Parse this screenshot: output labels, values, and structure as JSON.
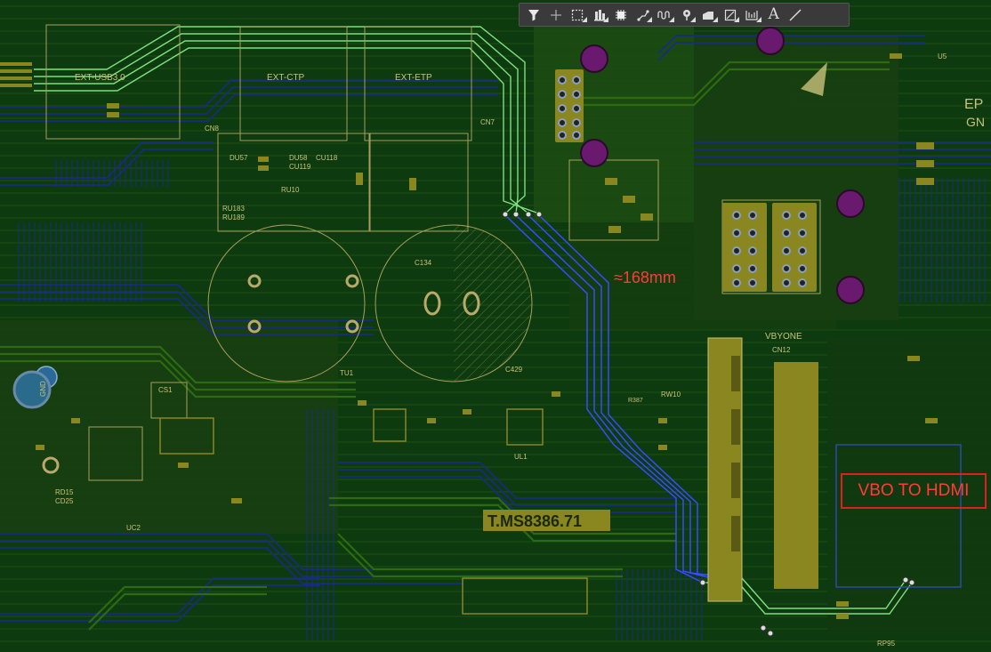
{
  "toolbar": {
    "tools": [
      {
        "icon": "filter-icon",
        "tooltip": "Filter"
      },
      {
        "icon": "crosshair-icon",
        "tooltip": "Place"
      },
      {
        "icon": "select-rectangle-icon",
        "tooltip": "Select"
      },
      {
        "icon": "align-icon",
        "tooltip": "Align"
      },
      {
        "icon": "component-icon",
        "tooltip": "Component"
      },
      {
        "icon": "route-track-icon",
        "tooltip": "Route"
      },
      {
        "icon": "diff-pair-length-icon",
        "tooltip": "Length Tuning"
      },
      {
        "icon": "via-icon",
        "tooltip": "Via"
      },
      {
        "icon": "polygon-pour-icon",
        "tooltip": "Polygon"
      },
      {
        "icon": "dimension-icon",
        "tooltip": "Dimension"
      },
      {
        "icon": "keepout-icon",
        "tooltip": "Keepout"
      },
      {
        "icon": "text-icon",
        "tooltip": "String",
        "glyph": "A"
      },
      {
        "icon": "line-icon",
        "tooltip": "Line"
      }
    ]
  },
  "annotations": {
    "length": "≈168mm",
    "box_label": "VBO TO HDMI",
    "color": "#ff3b3b"
  },
  "board": {
    "labels": {
      "ext_usb": "EXT-USB3.0",
      "ext_ctp": "EXT-CTP",
      "ext_etp": "EXT-ETP",
      "vbyone": "VBYONE",
      "cn12": "CN12",
      "part_number": "T.MS8386.71",
      "cn8": "CN8",
      "cn7": "CN7",
      "cu118": "CU118",
      "du57": "DU57",
      "du58": "DU58",
      "cu119": "CU119",
      "ru183": "RU183",
      "ru189": "RU189",
      "ru10": "RU10",
      "c134": "C134",
      "c429": "C429",
      "tu1": "TU1",
      "cs1": "CS1",
      "gnd": "GND",
      "rd15": "RD15",
      "cd25": "CD25",
      "uc2": "UC2",
      "ul1": "UL1",
      "rw10": "RW10",
      "r387": "R387",
      "rp95": "RP95",
      "u5": "U5",
      "gn": "GN",
      "ep": "EP"
    },
    "colors": {
      "background": "#0d3a0f",
      "top_copper": "#2d6a12",
      "bottom_copper": "#1a2a88",
      "selected_trace_green": "#7ee07e",
      "selected_trace_blue": "#3a4aff",
      "silkscreen": "#c9c27a",
      "pad": "#8a8620",
      "via_magenta": "#7a1f7a"
    }
  }
}
